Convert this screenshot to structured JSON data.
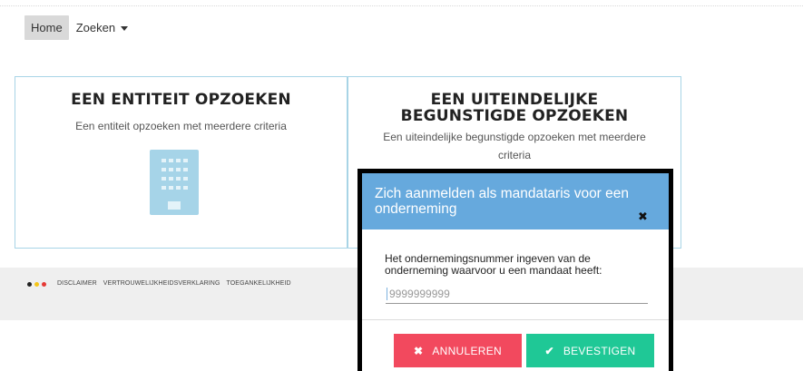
{
  "nav": {
    "home_label": "Home",
    "search_label": "Zoeken"
  },
  "cards": [
    {
      "title": "EEN ENTITEIT OPZOEKEN",
      "description": "Een entiteit opzoeken met meerdere criteria",
      "icon": "building-icon"
    },
    {
      "title": "EEN UITEINDELIJKE BEGUNSTIGDE OPZOEKEN",
      "description": "Een uiteindelijke begunstigde opzoeken met meerdere criteria"
    }
  ],
  "footer": {
    "flag_colors": [
      "#222222",
      "#f5c518",
      "#e53935"
    ],
    "links": [
      "DISCLAIMER",
      "VERTROUWELIJKHEIDSVERKLARING",
      "TOEGANKELIJKHEID"
    ]
  },
  "modal": {
    "title": "Zich aanmelden als mandataris voor een onderneming",
    "close_icon": "✖",
    "label": "Het ondernemingsnummer ingeven van de onderneming waarvoor u een mandaat heeft:",
    "input_placeholder": "9999999999",
    "input_value": "",
    "cancel_label": "ANNULEREN",
    "confirm_label": "BEVESTIGEN",
    "colors": {
      "header": "#66a9dd",
      "cancel": "#f2495e",
      "confirm": "#1fc896"
    }
  }
}
